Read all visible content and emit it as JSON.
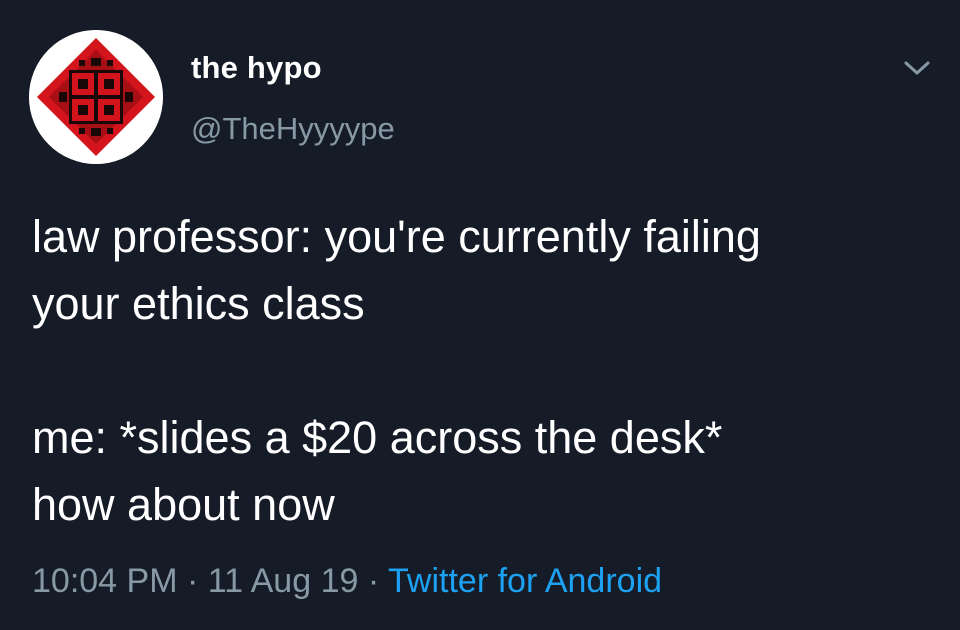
{
  "author": {
    "display_name": "the hypo",
    "handle": "@TheHyyyype"
  },
  "avatar": {
    "icon": "red-diamond-fractal-avatar-icon",
    "colors": {
      "ring": "#ffffff",
      "red": "#d4141c",
      "dark": "#1a0808"
    }
  },
  "menu": {
    "icon": "chevron-down-icon"
  },
  "tweet": {
    "lines_part1": [
      "law professor: you're currently failing",
      "your ethics class"
    ],
    "lines_part2": [
      "me: *slides a $20 across the desk*",
      "how about now"
    ]
  },
  "meta": {
    "time": "10:04 PM",
    "separator": "·",
    "date": "11 Aug 19",
    "source": "Twitter for Android"
  },
  "colors": {
    "background": "#151c28",
    "text": "#ffffff",
    "muted": "#8899a6",
    "link": "#1da1f2"
  }
}
